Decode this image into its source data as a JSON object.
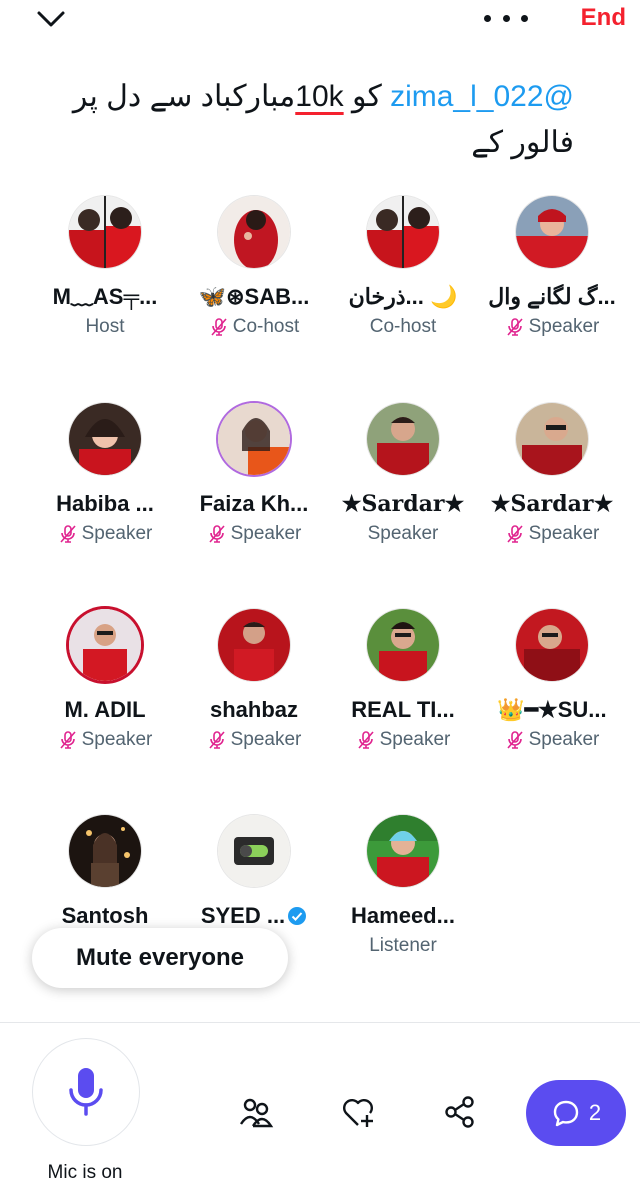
{
  "header": {
    "end_label": "End"
  },
  "title": {
    "prefix": "مبارکباد سے دل پر فالور کے ",
    "k": "10k",
    "mid": " کو ",
    "mention": "@zima_l_022"
  },
  "participants": [
    {
      "name": "M﹏AS╤...",
      "role": "Host"
    },
    {
      "name": "🦋⊛SAB...",
      "role": "Co-host"
    },
    {
      "name": "ذرخان... 🌙",
      "role": "Co-host"
    },
    {
      "name": "گ لگانے وال...",
      "role": "Speaker"
    },
    {
      "name": "Habiba ...",
      "role": "Speaker"
    },
    {
      "name": "Faiza Kh...",
      "role": "Speaker"
    },
    {
      "name": "★Sardar★",
      "role": "Speaker"
    },
    {
      "name": "★Sardar★",
      "role": "Speaker"
    },
    {
      "name": "M. ADIL",
      "role": "Speaker"
    },
    {
      "name": "shahbaz",
      "role": "Speaker"
    },
    {
      "name": "REAL TI...",
      "role": "Speaker"
    },
    {
      "name": "👑━★SU...",
      "role": "Speaker"
    },
    {
      "name": "Santosh",
      "role": ""
    },
    {
      "name": "SYED ...",
      "role": ""
    },
    {
      "name": "Hameed...",
      "role": "Listener"
    }
  ],
  "mute_everyone_label": "Mute everyone",
  "controls": {
    "mic_label": "Mic is on",
    "chat_count": "2"
  },
  "colors": {
    "accent": "#5b4cf0",
    "end_red": "#f4212e",
    "mention_blue": "#1d9bf0",
    "mic_off_pink": "#e0248f"
  }
}
